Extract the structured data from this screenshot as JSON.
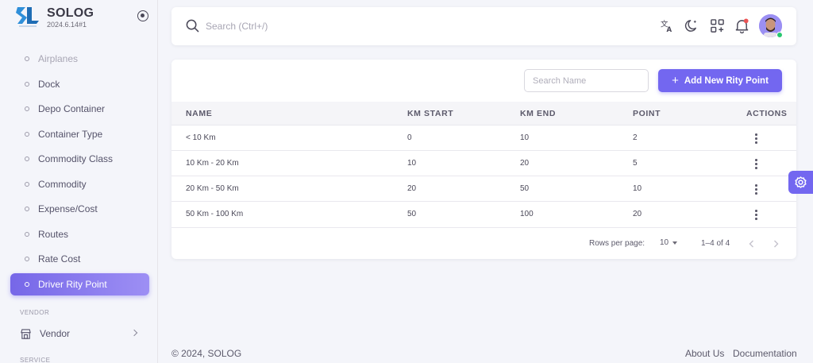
{
  "brand": {
    "name": "SOLOG",
    "version": "2024.6.14#1"
  },
  "sidebar": {
    "items": [
      {
        "label": "Airplanes"
      },
      {
        "label": "Dock"
      },
      {
        "label": "Depo Container"
      },
      {
        "label": "Container Type"
      },
      {
        "label": "Commodity Class"
      },
      {
        "label": "Commodity"
      },
      {
        "label": "Expense/Cost"
      },
      {
        "label": "Routes"
      },
      {
        "label": "Rate Cost"
      },
      {
        "label": "Driver Rity Point"
      }
    ],
    "vendor_section": "VENDOR",
    "vendor_item": "Vendor",
    "service_section": "SERVICE"
  },
  "header": {
    "search_placeholder": "Search (Ctrl+/)"
  },
  "card": {
    "search_placeholder": "Search Name",
    "add_label": "Add New Rity Point",
    "columns": [
      "NAME",
      "KM START",
      "KM END",
      "POINT",
      "ACTIONS"
    ],
    "rows": [
      {
        "name": "< 10 Km",
        "km_start": "0",
        "km_end": "10",
        "point": "2"
      },
      {
        "name": "10 Km - 20 Km",
        "km_start": "10",
        "km_end": "20",
        "point": "5"
      },
      {
        "name": "20 Km - 50 Km",
        "km_start": "20",
        "km_end": "50",
        "point": "10"
      },
      {
        "name": "50 Km - 100 Km",
        "km_start": "50",
        "km_end": "100",
        "point": "20"
      }
    ],
    "pagination": {
      "rows_per_page_label": "Rows per page:",
      "rows_per_page": "10",
      "range": "1–4 of 4"
    }
  },
  "footer": {
    "copyright": "© 2024, SOLOG",
    "about": "About Us",
    "docs": "Documentation"
  },
  "colors": {
    "primary": "#7367f0",
    "online": "#28c76f",
    "notification": "#ea5455"
  }
}
